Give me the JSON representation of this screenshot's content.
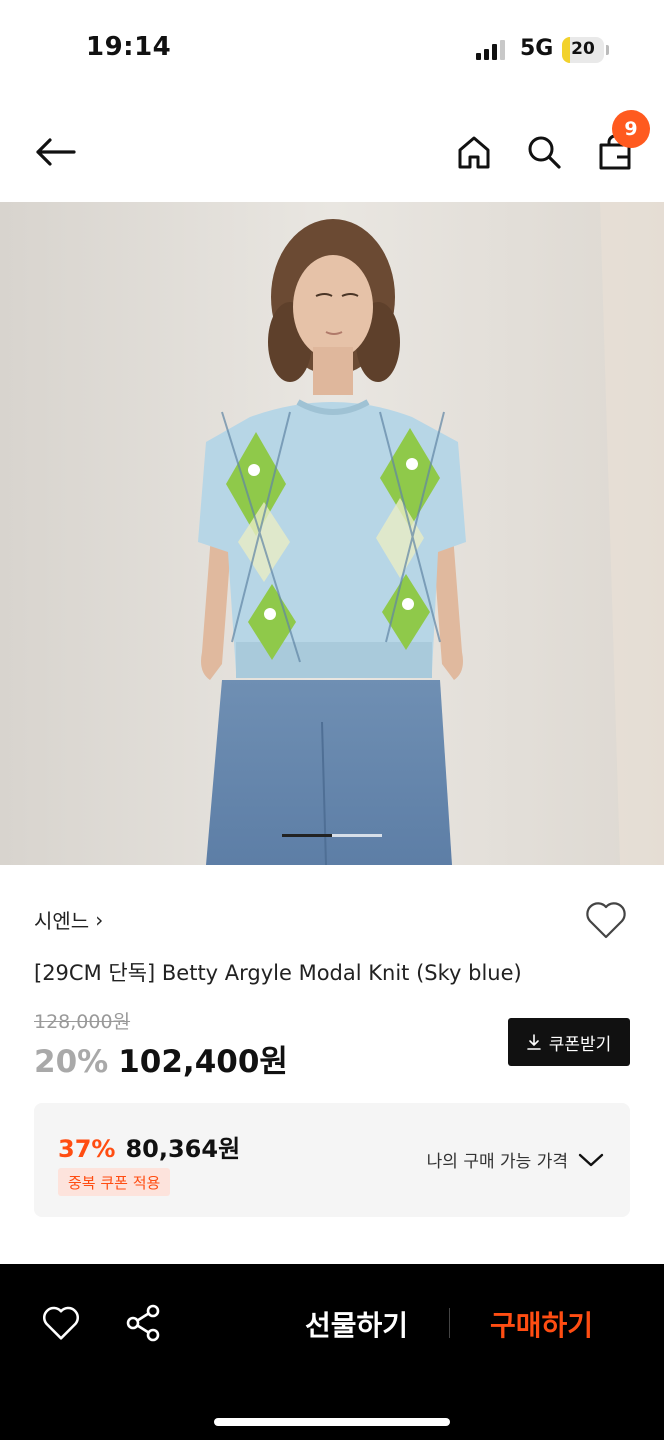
{
  "status_bar": {
    "time": "19:14",
    "network": "5G",
    "battery": "20",
    "battery_level_percent": 20,
    "battery_color": "#f2d22c"
  },
  "nav": {
    "back_icon": "arrow-left-icon",
    "home_icon": "home-icon",
    "search_icon": "search-icon",
    "cart_icon": "shopping-bag-icon",
    "cart_count": "9",
    "badge_color": "#ff5a1f"
  },
  "gallery": {
    "image_description": "product-photo-model-wearing-knit",
    "current_index": 1,
    "total": 3
  },
  "product": {
    "brand": "시엔느",
    "brand_chevron": "›",
    "title": "[29CM 단독] Betty Argyle Modal Knit (Sky blue)",
    "original_price": "128,000원",
    "discount": "20%",
    "price": "102,400원",
    "coupon_button": "쿠폰받기",
    "wish_icon": "heart-outline-icon"
  },
  "best_price": {
    "discount": "37%",
    "price": "80,364원",
    "tag": "중복 쿠폰 적용",
    "label": "나의 구매 가능 가격",
    "accent": "#ff4d12"
  },
  "bottom_bar": {
    "like_icon": "heart-outline-icon",
    "share_icon": "share-icon",
    "gift_label": "선물하기",
    "buy_label": "구매하기",
    "buy_color": "#ff4d12"
  }
}
